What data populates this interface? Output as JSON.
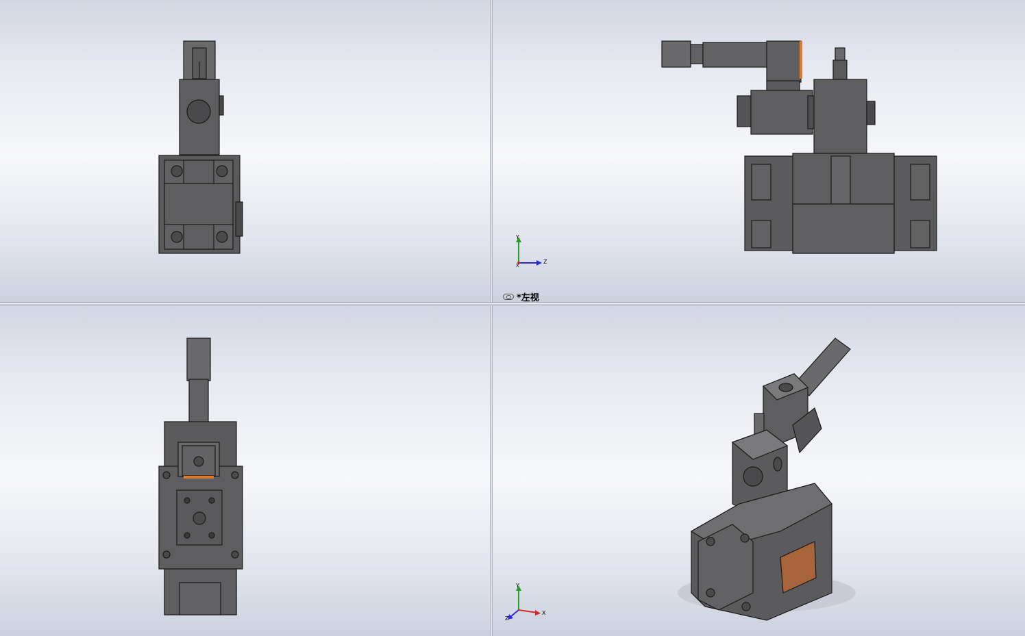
{
  "views": [
    {
      "id": "front",
      "name": "front-view"
    },
    {
      "id": "left",
      "name": "left-view",
      "label": "*左视"
    },
    {
      "id": "top",
      "name": "top-view"
    },
    {
      "id": "iso",
      "name": "isometric-view"
    }
  ],
  "triad_left": {
    "y": "Y",
    "z": "Z",
    "x": "X"
  },
  "triad_iso": {
    "y": "Y",
    "x": "X",
    "z": "Z"
  },
  "colors": {
    "metal": "#5e5e60",
    "metal_light": "#737375",
    "metal_dark": "#3a3a3c",
    "edge": "#1a1a1a",
    "copper": "#a8643a",
    "orange_stripe": "#e07b2a",
    "axis_x": "#d92626",
    "axis_y": "#2a9a2a",
    "axis_z": "#2a2ad9"
  }
}
